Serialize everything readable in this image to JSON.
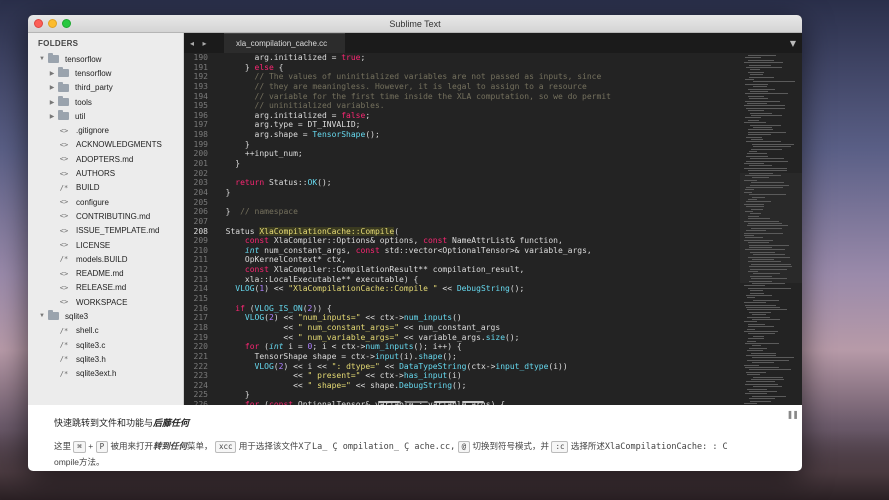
{
  "window": {
    "title": "Sublime Text"
  },
  "sidebar": {
    "header": "FOLDERS",
    "items": [
      {
        "label": "tensorflow",
        "kind": "folder",
        "depth": 0,
        "open": true
      },
      {
        "label": "tensorflow",
        "kind": "folder",
        "depth": 1,
        "open": false
      },
      {
        "label": "third_party",
        "kind": "folder",
        "depth": 1,
        "open": false
      },
      {
        "label": "tools",
        "kind": "folder",
        "depth": 1,
        "open": false
      },
      {
        "label": "util",
        "kind": "folder",
        "depth": 1,
        "open": false
      },
      {
        "label": ".gitignore",
        "kind": "file",
        "icon": "<>",
        "depth": 1
      },
      {
        "label": "ACKNOWLEDGMENTS",
        "kind": "file",
        "icon": "<>",
        "depth": 1
      },
      {
        "label": "ADOPTERS.md",
        "kind": "file",
        "icon": "<>",
        "depth": 1
      },
      {
        "label": "AUTHORS",
        "kind": "file",
        "icon": "<>",
        "depth": 1
      },
      {
        "label": "BUILD",
        "kind": "file",
        "icon": "/*",
        "depth": 1
      },
      {
        "label": "configure",
        "kind": "file",
        "icon": "<>",
        "depth": 1
      },
      {
        "label": "CONTRIBUTING.md",
        "kind": "file",
        "icon": "<>",
        "depth": 1
      },
      {
        "label": "ISSUE_TEMPLATE.md",
        "kind": "file",
        "icon": "<>",
        "depth": 1
      },
      {
        "label": "LICENSE",
        "kind": "file",
        "icon": "<>",
        "depth": 1
      },
      {
        "label": "models.BUILD",
        "kind": "file",
        "icon": "/*",
        "depth": 1
      },
      {
        "label": "README.md",
        "kind": "file",
        "icon": "<>",
        "depth": 1
      },
      {
        "label": "RELEASE.md",
        "kind": "file",
        "icon": "<>",
        "depth": 1
      },
      {
        "label": "WORKSPACE",
        "kind": "file",
        "icon": "<>",
        "depth": 1
      },
      {
        "label": "sqlite3",
        "kind": "folder",
        "depth": 0,
        "open": true
      },
      {
        "label": "shell.c",
        "kind": "file",
        "icon": "/*",
        "depth": 1
      },
      {
        "label": "sqlite3.c",
        "kind": "file",
        "icon": "/*",
        "depth": 1
      },
      {
        "label": "sqlite3.h",
        "kind": "file",
        "icon": "/*",
        "depth": 1
      },
      {
        "label": "sqlite3ext.h",
        "kind": "file",
        "icon": "/*",
        "depth": 1
      }
    ]
  },
  "tabs": {
    "nav": "◂ ▸",
    "active": "xla_compilation_cache.cc",
    "menu": "▼"
  },
  "editor": {
    "current_line": "208",
    "lines": [
      {
        "n": "190",
        "html": "        arg.initialized = <span class=\"kw\">true</span>;"
      },
      {
        "n": "191",
        "html": "      } <span class=\"kw\">else</span> {"
      },
      {
        "n": "192",
        "html": "        <span class=\"cm\">// The values of uninitialized variables are not passed as inputs, since</span>"
      },
      {
        "n": "193",
        "html": "        <span class=\"cm\">// they are meaningless. However, it is legal to assign to a resource</span>"
      },
      {
        "n": "194",
        "html": "        <span class=\"cm\">// variable for the first time inside the XLA computation, so we do permit</span>"
      },
      {
        "n": "195",
        "html": "        <span class=\"cm\">// uninitialized variables.</span>"
      },
      {
        "n": "196",
        "html": "        arg.initialized = <span class=\"kw\">false</span>;"
      },
      {
        "n": "197",
        "html": "        arg.type = DT_INVALID;"
      },
      {
        "n": "198",
        "html": "        arg.shape = <span class=\"fn\">TensorShape</span>();"
      },
      {
        "n": "199",
        "html": "      }"
      },
      {
        "n": "200",
        "html": "      ++input_num;"
      },
      {
        "n": "201",
        "html": "    }"
      },
      {
        "n": "202",
        "html": ""
      },
      {
        "n": "203",
        "html": "    <span class=\"kw\">return</span> Status::<span class=\"fn\">OK</span>();"
      },
      {
        "n": "204",
        "html": "  }"
      },
      {
        "n": "205",
        "html": ""
      },
      {
        "n": "206",
        "html": "  }  <span class=\"cm\">// namespace</span>"
      },
      {
        "n": "207",
        "html": ""
      },
      {
        "n": "208",
        "html": "  Status <span class=\"hl\">XlaCompilationCache::Compile</span>("
      },
      {
        "n": "209",
        "html": "      <span class=\"kw\">const</span> XlaCompiler::Options&amp; options, <span class=\"kw\">const</span> NameAttrList&amp; function,"
      },
      {
        "n": "210",
        "html": "      <span class=\"ty\">int</span> num_constant_args, <span class=\"kw\">const</span> std::vector&lt;OptionalTensor&gt;&amp; variable_args,"
      },
      {
        "n": "211",
        "html": "      OpKernelContext* ctx,"
      },
      {
        "n": "212",
        "html": "      <span class=\"kw\">const</span> XlaCompiler::CompilationResult** compilation_result,"
      },
      {
        "n": "213",
        "html": "      xla::LocalExecutable** executable) {"
      },
      {
        "n": "214",
        "html": "    <span class=\"fn\">VLOG</span>(<span class=\"num\">1</span>) &lt;&lt; <span class=\"str\">\"XlaCompilationCache::Compile \"</span> &lt;&lt; <span class=\"fn\">DebugString</span>();"
      },
      {
        "n": "215",
        "html": ""
      },
      {
        "n": "216",
        "html": "    <span class=\"kw\">if</span> (<span class=\"fn\">VLOG_IS_ON</span>(<span class=\"num\">2</span>)) {"
      },
      {
        "n": "217",
        "html": "      <span class=\"fn\">VLOG</span>(<span class=\"num\">2</span>) &lt;&lt; <span class=\"str\">\"num_inputs=\"</span> &lt;&lt; ctx-&gt;<span class=\"fn\">num_inputs</span>()"
      },
      {
        "n": "218",
        "html": "              &lt;&lt; <span class=\"str\">\" num_constant_args=\"</span> &lt;&lt; num_constant_args"
      },
      {
        "n": "219",
        "html": "              &lt;&lt; <span class=\"str\">\" num_variable_args=\"</span> &lt;&lt; variable_args.<span class=\"fn\">size</span>();"
      },
      {
        "n": "220",
        "html": "      <span class=\"kw\">for</span> (<span class=\"ty\">int</span> i = <span class=\"num\">0</span>; i &lt; ctx-&gt;<span class=\"fn\">num_inputs</span>(); i++) {"
      },
      {
        "n": "221",
        "html": "        TensorShape shape = ctx-&gt;<span class=\"fn\">input</span>(i).<span class=\"fn\">shape</span>();"
      },
      {
        "n": "222",
        "html": "        <span class=\"fn\">VLOG</span>(<span class=\"num\">2</span>) &lt;&lt; i &lt;&lt; <span class=\"str\">\": dtype=\"</span> &lt;&lt; <span class=\"fn\">DataTypeString</span>(ctx-&gt;<span class=\"fn\">input_dtype</span>(i))"
      },
      {
        "n": "223",
        "html": "                &lt;&lt; <span class=\"str\">\" present=\"</span> &lt;&lt; ctx-&gt;<span class=\"fn\">has_input</span>(i)"
      },
      {
        "n": "224",
        "html": "                &lt;&lt; <span class=\"str\">\" shape=\"</span> &lt;&lt; shape.<span class=\"fn\">DebugString</span>();"
      },
      {
        "n": "225",
        "html": "      }"
      },
      {
        "n": "226",
        "html": "      <span class=\"kw\">for</span> (<span class=\"kw\">const</span> OptionalTensor&amp; variable : variable_args) {"
      }
    ]
  },
  "banner": {
    "title_prefix": "快速跳转到文件和功能与",
    "title_bold": "后藤任何",
    "desc_1": "这里",
    "key_cmd": "⌘",
    "plus": "+",
    "key_p": "P",
    "desc_2": "被用来打开",
    "desc_bold": "转到任何",
    "desc_3": "菜单，",
    "code_xcc": "xcc",
    "desc_4": "用于选择该文件",
    "desc_5": "X了La_ Ç ompilation_ Ç ache.cc,",
    "code_at": "@",
    "desc_6": "切换到符号模式，并",
    "code_c": ":c",
    "desc_7": "选择所述",
    "code_sym": "XlaCompilationCache: : C",
    "desc_8": "ompile方法。"
  },
  "colors": {
    "keyword": "#f92672",
    "function": "#66d9ef",
    "string": "#e6db74",
    "comment": "#75715e",
    "number": "#ae81ff"
  }
}
